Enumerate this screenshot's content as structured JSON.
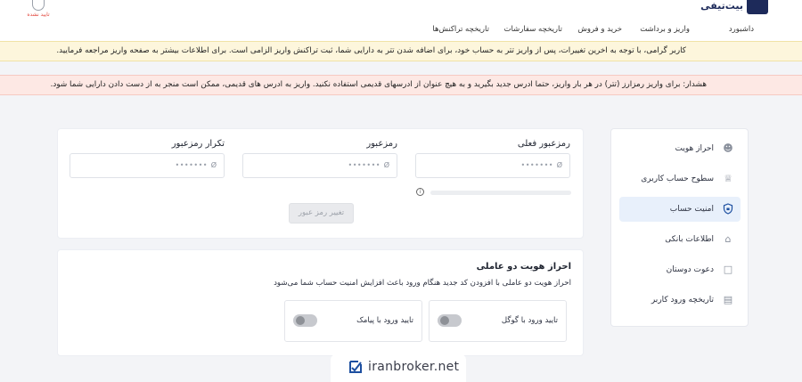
{
  "header": {
    "logo_text": "بیت‌تیفی",
    "user_status": "تایید نشده",
    "nav": [
      {
        "label": "داشبورد"
      },
      {
        "label": "واریز و برداشت"
      },
      {
        "label": "خرید و فروش"
      },
      {
        "label": "تاریخچه سفارشات"
      },
      {
        "label": "تاریخچه تراکنش‌ها"
      }
    ]
  },
  "alerts": {
    "info": "کاربر گرامی، با توجه به اخرین تغییرات، پس از واریز تتر به حساب خود، برای اضافه شدن تتر به دارایی شما، ثبت تراکنش واریز الزامی است. برای اطلاعات بیشتر به صفحه واریز مراجعه فرمایید.",
    "warning": "هشدار: برای واریز رمزارز (تتر) در هر بار واریز، حتما ادرس جدید بگیرید و به هیچ عنوان از ادرسهای قدیمی استفاده نکنید. واریز به ادرس های قدیمی، ممکن است منجر به از دست دادن دارایی شما شود."
  },
  "sidebar": {
    "items": [
      {
        "label": "احراز هویت",
        "icon": "user-check-icon"
      },
      {
        "label": "سطوح حساب کاربری",
        "icon": "crown-icon"
      },
      {
        "label": "امنیت حساب",
        "icon": "shield-icon",
        "active": true
      },
      {
        "label": "اطلاعات بانکی",
        "icon": "bank-icon"
      },
      {
        "label": "دعوت دوستان",
        "icon": "gift-icon"
      },
      {
        "label": "تاریخچه ورود کاربر",
        "icon": "id-card-icon"
      }
    ]
  },
  "password": {
    "current_label": "رمزعبور فعلی",
    "new_label": "رمزعبور",
    "repeat_label": "تکرار رمزعبور",
    "masked": "•••••••",
    "strength": 0,
    "submit_label": "تغییر رمز عبور"
  },
  "two_factor": {
    "title": "احراز هویت دو عاملی",
    "description": "احراز هویت دو عاملی با افزودن کد جدید هنگام ورود باعث افزایش امنیت حساب شما می‌شود",
    "google_label": "تایید ورود با گوگل",
    "sms_label": "تایید ورود با پیامک",
    "google_enabled": false,
    "sms_enabled": false
  },
  "watermark": {
    "text": "iranbroker.net"
  },
  "colors": {
    "brand": "#1d2a5a",
    "accent": "#1d4fa0",
    "info_bg": "#fdf6dc",
    "warning_bg": "#fde8e4"
  }
}
